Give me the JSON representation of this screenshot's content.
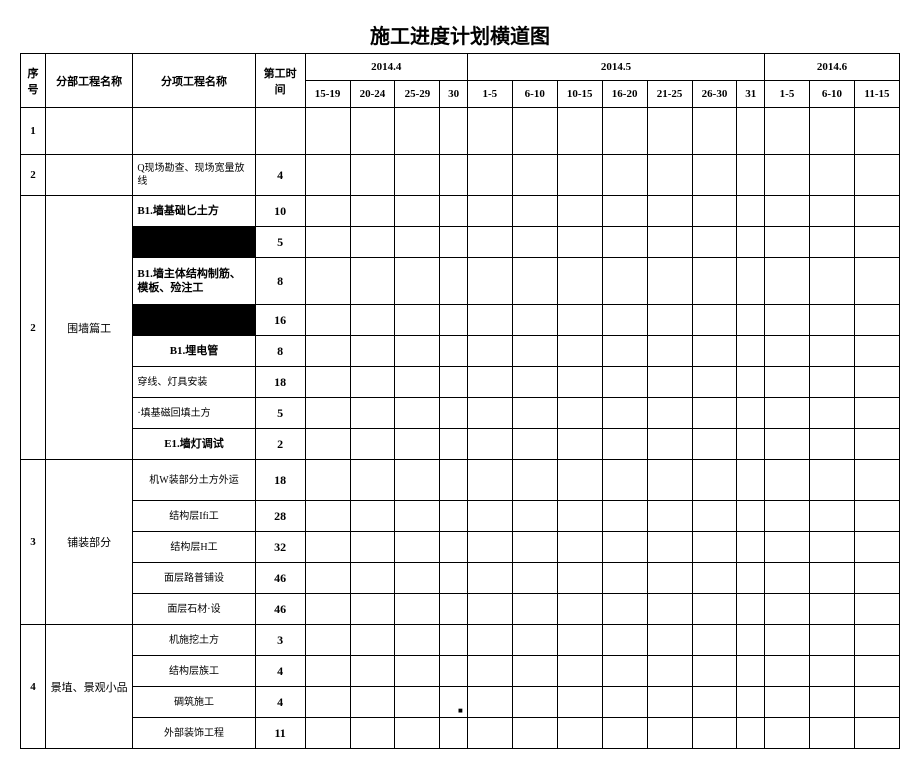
{
  "title": "施工进度计划横道图",
  "headers": {
    "seq": "序号",
    "category": "分部工程名称",
    "item": "分项工程名称",
    "duration": "第工时间",
    "month1": "2014.4",
    "month2": "2014.5",
    "month3": "2014.6",
    "d1": "15-19",
    "d2": "20-24",
    "d3": "25-29",
    "d4": "30",
    "d5": "1-5",
    "d6": "6-10",
    "d7": "10-15",
    "d8": "16-20",
    "d9": "21-25",
    "d10": "26-30",
    "d11": "31",
    "d12": "1-5",
    "d13": "6-10",
    "d14": "11-15"
  },
  "rows": [
    {
      "seq": "1",
      "cat": "",
      "item": "",
      "dur": ""
    },
    {
      "seq": "2",
      "cat": "",
      "item": "Q现场勘查、现场宽量放线",
      "dur": "4"
    },
    {
      "seq": "2",
      "cat": "围墙篇工",
      "item1": "B1.墙基础匕土方",
      "dur1": "10",
      "item2": "",
      "dur2": "5",
      "item3": "B1.墙主体结构制筋、模板、殓注工",
      "dur3": "8",
      "item4": "",
      "dur4": "16",
      "item5": "B1.埋电管",
      "dur5": "8",
      "item6": "穿线、灯具安装",
      "dur6": "18",
      "item7": "·填基磁回填土方",
      "dur7": "5",
      "item8": "E1.墙灯调试",
      "dur8": "2"
    },
    {
      "seq": "3",
      "cat": "铺装部分",
      "item1": "机W装部分土方外运",
      "dur1": "18",
      "item2": "结构层Ifi工",
      "dur2": "28",
      "item3": "结构层H工",
      "dur3": "32",
      "item4": "面层路普铺设",
      "dur4": "46",
      "item5": "面层石材·设",
      "dur5": "46"
    },
    {
      "seq": "4",
      "cat": "景埴、景观小品",
      "item1": "机施挖土方",
      "dur1": "3",
      "item2": "结构层族工",
      "dur2": "4",
      "item3": "碉筑施工",
      "dur3": "4",
      "item4": "外部装饰工程",
      "dur4": "11"
    }
  ]
}
